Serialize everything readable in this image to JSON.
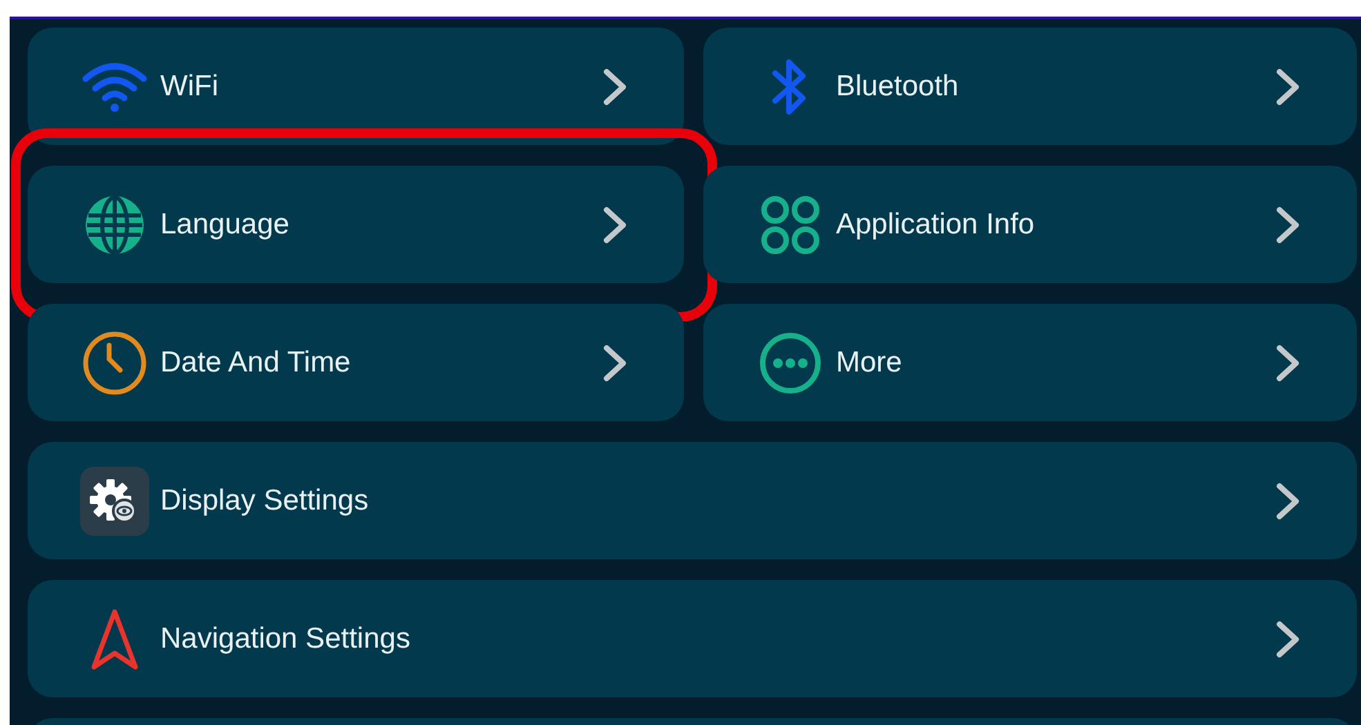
{
  "settings": [
    {
      "label": "WiFi",
      "kind": "wifi",
      "wide": false,
      "highlighted": false
    },
    {
      "label": "Bluetooth",
      "kind": "bluetooth",
      "wide": false,
      "highlighted": false
    },
    {
      "label": "Language",
      "kind": "globe",
      "wide": false,
      "highlighted": true
    },
    {
      "label": "Application Info",
      "kind": "apps",
      "wide": false,
      "highlighted": false
    },
    {
      "label": "Date And Time",
      "kind": "clock",
      "wide": false,
      "highlighted": false
    },
    {
      "label": "More",
      "kind": "more",
      "wide": false,
      "highlighted": false
    },
    {
      "label": "Display Settings",
      "kind": "display",
      "wide": true,
      "highlighted": false
    },
    {
      "label": "Navigation Settings",
      "kind": "navigation",
      "wide": true,
      "highlighted": false
    }
  ]
}
